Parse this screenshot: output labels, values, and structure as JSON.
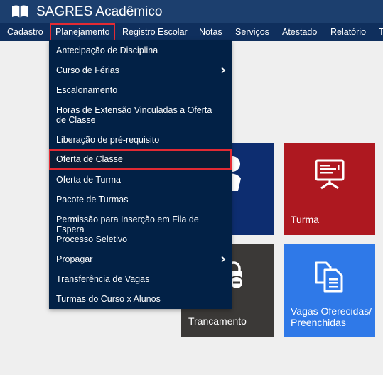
{
  "app": {
    "title": "SAGRES Acadêmico"
  },
  "nav": {
    "items": [
      {
        "label": "Cadastro"
      },
      {
        "label": "Planejamento"
      },
      {
        "label": "Registro Escolar"
      },
      {
        "label": "Notas"
      },
      {
        "label": "Serviços"
      },
      {
        "label": "Atestado"
      },
      {
        "label": "Relatório"
      },
      {
        "label": "T"
      }
    ],
    "active": "Planejamento"
  },
  "dropdown": {
    "items": [
      {
        "label": "Antecipação de Disciplina"
      },
      {
        "label": "Curso de Férias",
        "submenu": true
      },
      {
        "label": "Escalonamento"
      },
      {
        "label": "Horas de Extensão Vinculadas a Oferta de Classe"
      },
      {
        "label": "Liberação de pré-requisito"
      },
      {
        "label": "Oferta de Classe",
        "highlighted": true
      },
      {
        "label": "Oferta de Turma"
      },
      {
        "label": "Pacote de Turmas"
      },
      {
        "label": "Permissão para Inserção em Fila de Espera"
      },
      {
        "label": "Processo Seletivo"
      },
      {
        "label": "Propagar",
        "submenu": true
      },
      {
        "label": "Transferência de Vagas"
      },
      {
        "label": "Turmas do Curso x Alunos"
      }
    ]
  },
  "tiles": [
    {
      "label": "",
      "icon": "person-icon",
      "color": "#0d2d70"
    },
    {
      "label": "Turma",
      "icon": "presentation-board-icon",
      "color": "#ae1820"
    },
    {
      "label": "Trancamento",
      "icon": "lock-minus-icon",
      "color": "#3b3937"
    },
    {
      "label": "Vagas Oferecidas/ Preenchidas",
      "icon": "documents-icon",
      "color": "#2f79e8"
    }
  ],
  "colors": {
    "topbar": "#1c3f6e",
    "navbar": "#0f2f5d",
    "dropdown": "#022146",
    "highlight_border": "#e32a33",
    "background": "#efefef"
  }
}
